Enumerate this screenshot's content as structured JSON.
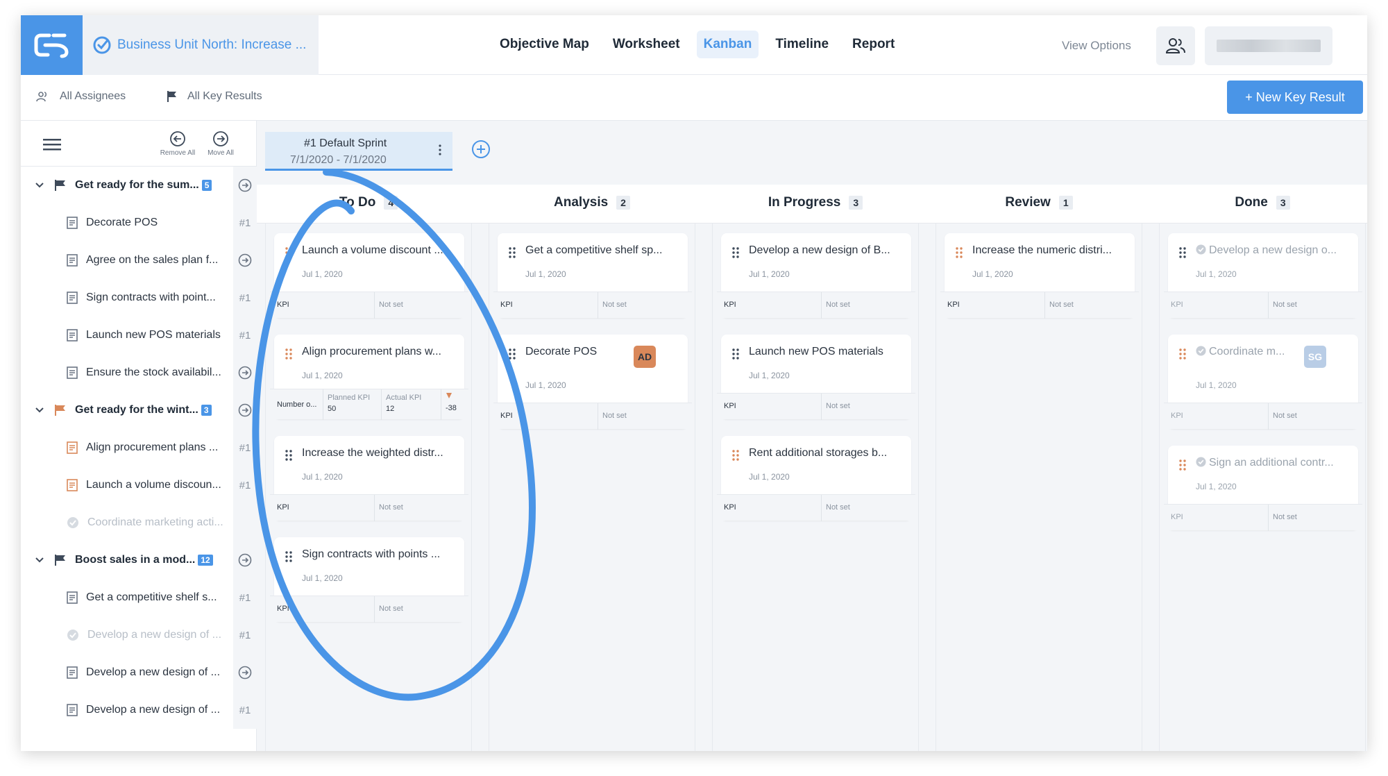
{
  "header": {
    "objective_title": "Business Unit North: Increase ...",
    "tabs": [
      {
        "label": "Objective Map"
      },
      {
        "label": "Worksheet"
      },
      {
        "label": "Kanban"
      },
      {
        "label": "Timeline"
      },
      {
        "label": "Report"
      }
    ],
    "active_tab": "Kanban",
    "view_options_label": "View Options"
  },
  "filters": {
    "assignees_label": "All Assignees",
    "key_results_label": "All Key Results",
    "new_key_result_label": "+ New Key Result"
  },
  "sidebar": {
    "remove_all_label": "Remove All",
    "move_all_label": "Move All",
    "rows": [
      {
        "type": "objective",
        "label": "Get ready for the sum...",
        "count": "5",
        "flag_color": "#3e4a5a",
        "right": "arrow"
      },
      {
        "type": "kr",
        "label": "Decorate POS",
        "right": "#1"
      },
      {
        "type": "kr",
        "label": "Agree on the sales plan f...",
        "right": "arrow"
      },
      {
        "type": "kr",
        "label": "Sign contracts with point...",
        "right": "#1"
      },
      {
        "type": "kr",
        "label": "Launch new POS materials",
        "right": "#1"
      },
      {
        "type": "kr",
        "label": "Ensure the stock availabil...",
        "right": "arrow"
      },
      {
        "type": "objective",
        "label": "Get ready for the wint...",
        "count": "3",
        "flag_color": "#d9885a",
        "right": "arrow"
      },
      {
        "type": "kr",
        "label": "Align procurement plans ...",
        "right": "#1",
        "icon_color": "#d9885a"
      },
      {
        "type": "kr",
        "label": "Launch a volume discoun...",
        "right": "#1",
        "icon_color": "#d9885a"
      },
      {
        "type": "kr-done",
        "label": "Coordinate marketing acti...",
        "right": ""
      },
      {
        "type": "objective",
        "label": "Boost sales in a mod...",
        "count": "12",
        "flag_color": "#3e4a5a",
        "right": "arrow"
      },
      {
        "type": "kr",
        "label": "Get a competitive shelf s...",
        "right": "#1"
      },
      {
        "type": "kr-done",
        "label": "Develop a new design of ...",
        "right": "#1"
      },
      {
        "type": "kr",
        "label": "Develop a new design of ...",
        "right": "arrow"
      },
      {
        "type": "kr",
        "label": "Develop a new design of ...",
        "right": "#1"
      }
    ]
  },
  "sprint": {
    "name": "#1 Default Sprint",
    "dates": "7/1/2020 - 7/1/2020"
  },
  "columns": [
    {
      "name": "To Do",
      "count": "4",
      "cards": [
        {
          "title": "Launch a volume discount ...",
          "date": "Jul 1, 2020",
          "kpi": "KPI",
          "value": "Not set",
          "grip": "orange"
        },
        {
          "title": "Align procurement plans w...",
          "date": "Jul 1, 2020",
          "kpi": "Number o...",
          "planned_label": "Planned KPI",
          "planned": "50",
          "actual_label": "Actual KPI",
          "actual": "12",
          "delta": "-38",
          "grip": "orange"
        },
        {
          "title": "Increase the weighted distr...",
          "date": "Jul 1, 2020",
          "kpi": "KPI",
          "value": "Not set",
          "grip": "gray"
        },
        {
          "title": "Sign contracts with points ...",
          "date": "Jul 1, 2020",
          "kpi": "KPI",
          "value": "Not set",
          "grip": "gray"
        }
      ]
    },
    {
      "name": "Analysis",
      "count": "2",
      "cards": [
        {
          "title": "Get a competitive shelf sp...",
          "date": "Jul 1, 2020",
          "kpi": "KPI",
          "value": "Not set",
          "grip": "gray"
        },
        {
          "title": "Decorate POS",
          "date": "Jul 1, 2020",
          "kpi": "KPI",
          "value": "Not set",
          "grip": "gray",
          "avatar": "AD",
          "avatar_color": "#d9885a"
        }
      ]
    },
    {
      "name": "In Progress",
      "count": "3",
      "cards": [
        {
          "title": "Develop a new design of B...",
          "date": "Jul 1, 2020",
          "kpi": "KPI",
          "value": "Not set",
          "grip": "gray"
        },
        {
          "title": "Launch new POS materials",
          "date": "Jul 1, 2020",
          "kpi": "KPI",
          "value": "Not set",
          "grip": "gray"
        },
        {
          "title": "Rent additional storages b...",
          "date": "Jul 1, 2020",
          "kpi": "KPI",
          "value": "Not set",
          "grip": "orange"
        }
      ]
    },
    {
      "name": "Review",
      "count": "1",
      "cards": [
        {
          "title": "Increase the numeric distri...",
          "date": "Jul 1, 2020",
          "kpi": "KPI",
          "value": "Not set",
          "grip": "orange"
        }
      ]
    },
    {
      "name": "Done",
      "count": "3",
      "cards": [
        {
          "title": "Develop a new design o...",
          "date": "Jul 1, 2020",
          "kpi": "KPI",
          "value": "Not set",
          "grip": "gray"
        },
        {
          "title": "Coordinate m...",
          "date": "Jul 1, 2020",
          "kpi": "KPI",
          "value": "Not set",
          "grip": "orange",
          "avatar": "SG",
          "avatar_color": "#b9cde6"
        },
        {
          "title": "Sign an additional contr...",
          "date": "Jul 1, 2020",
          "kpi": "KPI",
          "value": "Not set",
          "grip": "orange"
        }
      ]
    }
  ],
  "colors": {
    "accent": "#4a95e7",
    "orange": "#d9885a",
    "annotation": "#4a95e7"
  }
}
